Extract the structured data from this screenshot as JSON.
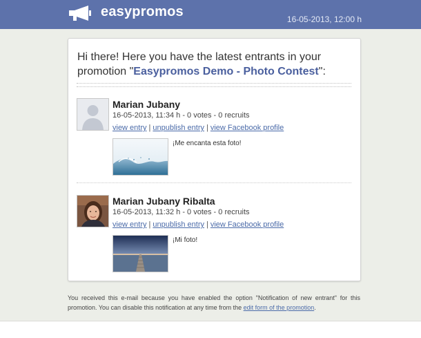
{
  "header": {
    "brand": "easypromos",
    "datetime": "16-05-2013, 12:00 h",
    "logo_icon": "megaphone-icon",
    "colors": {
      "bar": "#5d72ab",
      "text": "#ffffff"
    }
  },
  "intro": {
    "prefix": "Hi there! Here you have the latest entrants in your promotion \"",
    "promotion_name": "Easypromos Demo - Photo Contest",
    "suffix": "\":"
  },
  "links": {
    "view_entry": "view entry",
    "unpublish_entry": "unpublish entry",
    "view_profile": "view Facebook profile",
    "separator": "|"
  },
  "entries": [
    {
      "name": "Marian Jubany",
      "meta": "16-05-2013, 11:34 h - 0 votes - 0 recruits",
      "comment": "¡Me encanta esta foto!",
      "avatar_icon": "default-user-silhouette-icon",
      "photo_icon": "water-splash-photo"
    },
    {
      "name": "Marian Jubany Ribalta",
      "meta": "16-05-2013, 11:32 h - 0 votes - 0 recruits",
      "comment": "¡Mi foto!",
      "avatar_icon": "profile-photo",
      "photo_icon": "pier-sunset-photo"
    }
  ],
  "footer": {
    "text": "You received this e-mail because you have enabled the option \"Notification of new entrant\" for this promotion. You can disable this notification at any time from the ",
    "link_text": "edit form of the promotion",
    "end": "."
  }
}
